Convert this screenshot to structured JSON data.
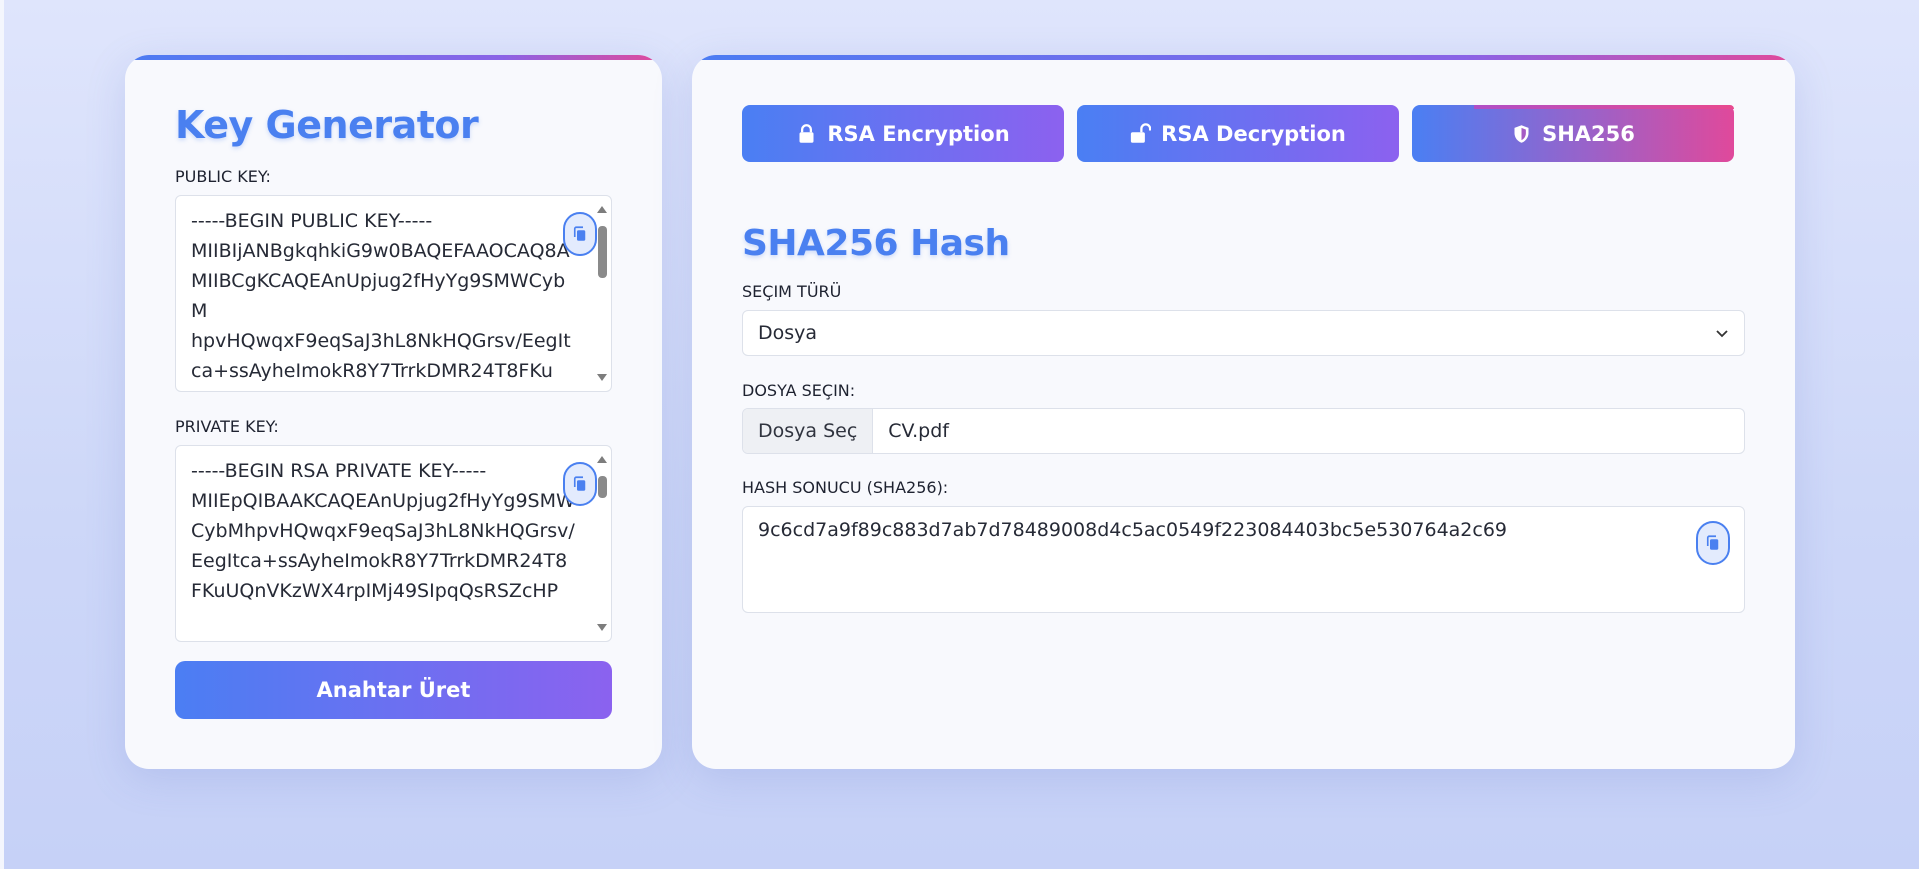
{
  "key_generator": {
    "title": "Key Generator",
    "public_key_label": "PUBLIC KEY:",
    "public_key_value": "-----BEGIN PUBLIC KEY-----\nMIIBIjANBgkqhkiG9w0BAQEFAAOCAQ8AMIIBCgKCAQEAnUpjug2fHyYg9SMWCybM\nhpvHQwqxF9eqSaJ3hL8NkHQGrsv/EegItca+ssAyheImokR8Y7TrrkDMR24T8FKu",
    "private_key_label": "PRIVATE KEY:",
    "private_key_value": "-----BEGIN RSA PRIVATE KEY-----\nMIIEpQIBAAKCAQEAnUpjug2fHyYg9SMWCybMhpvHQwqxF9eqSaJ3hL8NkHQGrsv/\nEegItca+ssAyheImokR8Y7TrrkDMR24T8FKuUQnVKzWX4rpIMj49SIpqQsRSZcHP",
    "generate_button": "Anahtar Üret",
    "copy_icon": "copy-icon"
  },
  "tabs": [
    {
      "label": "RSA Encryption",
      "icon": "lock-icon",
      "active": false
    },
    {
      "label": "RSA Decryption",
      "icon": "unlock-icon",
      "active": false
    },
    {
      "label": "SHA256",
      "icon": "shield-icon",
      "active": true
    }
  ],
  "sha_panel": {
    "title": "SHA256 Hash",
    "selection_type_label": "SEÇIM TÜRÜ",
    "selection_type_value": "Dosya",
    "file_label": "DOSYA SEÇIN:",
    "file_button": "Dosya Seç",
    "file_name": "CV.pdf",
    "hash_label": "HASH SONUCU (SHA256):",
    "hash_value": "9c6cd7a9f89c883d7ab7d78489008d4c5ac0549f223084403bc5e530764a2c69"
  },
  "colors": {
    "accent_blue": "#4a80f0",
    "accent_purple": "#8b62ef",
    "accent_pink": "#e0499b"
  }
}
